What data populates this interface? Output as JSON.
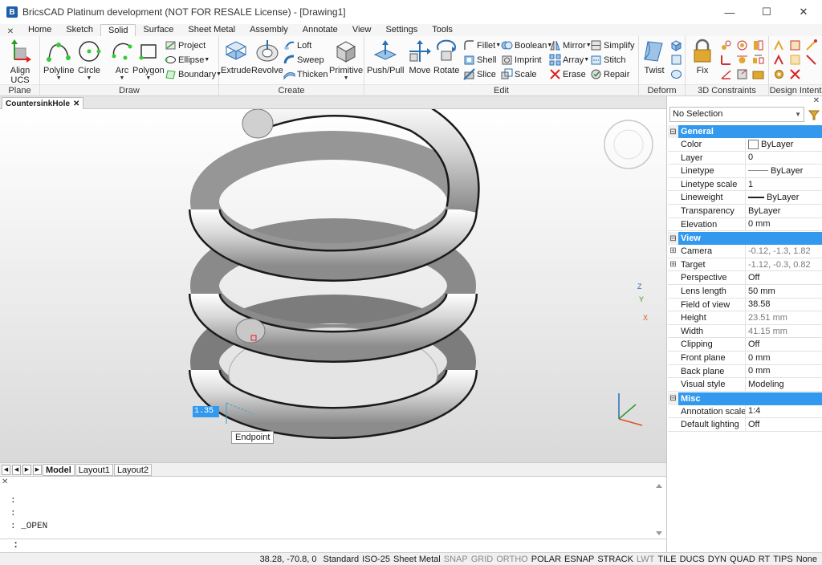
{
  "app": {
    "title": "BricsCAD Platinum development (NOT FOR RESALE License) - [Drawing1]",
    "logo_glyph": "B"
  },
  "window_controls": {
    "minimize": "—",
    "maximize": "☐",
    "close": "✕"
  },
  "ribbon_tabs": [
    "Home",
    "Sketch",
    "Solid",
    "Surface",
    "Sheet Metal",
    "Assembly",
    "Annotate",
    "View",
    "Settings",
    "Tools"
  ],
  "active_tab": "Solid",
  "ribbon": {
    "plane": {
      "label": "Plane",
      "align_ucs": "Align\nUCS"
    },
    "draw": {
      "label": "Draw",
      "polyline": "Polyline",
      "circle": "Circle",
      "arc": "Arc",
      "polygon": "Polygon",
      "project": "Project",
      "ellipse": "Ellipse",
      "boundary": "Boundary"
    },
    "create": {
      "label": "Create",
      "extrude": "Extrude",
      "revolve": "Revolve",
      "loft": "Loft",
      "sweep": "Sweep",
      "thicken": "Thicken",
      "primitive": "Primitive"
    },
    "edit": {
      "label": "Edit",
      "pushpull": "Push/Pull",
      "move": "Move",
      "rotate": "Rotate",
      "fillet": "Fillet",
      "shell": "Shell",
      "slice": "Slice",
      "boolean": "Boolean",
      "imprint": "Imprint",
      "scale": "Scale",
      "mirror": "Mirror",
      "array": "Array",
      "erase": "Erase",
      "simplify": "Simplify",
      "stitch": "Stitch",
      "repair": "Repair"
    },
    "deform": {
      "label": "Deform",
      "twist": "Twist"
    },
    "constraints": {
      "label": "3D Constraints",
      "fix": "Fix"
    },
    "design_intent": {
      "label": "Design Intent"
    }
  },
  "document_tab": "CountersinkHole",
  "viewport": {
    "dim_input": "1.35",
    "snap_tooltip": "Endpoint",
    "ucs_x": "X",
    "ucs_y": "Y",
    "ucs_z": "Z"
  },
  "layout_tabs": [
    "Model",
    "Layout1",
    "Layout2"
  ],
  "command_history": [
    ":",
    ":",
    ": _OPEN"
  ],
  "command_prompt": ":",
  "statusbar": {
    "coords": "38.28, -70.8, 0",
    "items": [
      {
        "text": "Standard",
        "off": false
      },
      {
        "text": "ISO-25",
        "off": false
      },
      {
        "text": "Sheet Metal",
        "off": false
      },
      {
        "text": "SNAP",
        "off": true
      },
      {
        "text": "GRID",
        "off": true
      },
      {
        "text": "ORTHO",
        "off": true
      },
      {
        "text": "POLAR",
        "off": false
      },
      {
        "text": "ESNAP",
        "off": false
      },
      {
        "text": "STRACK",
        "off": false
      },
      {
        "text": "LWT",
        "off": true
      },
      {
        "text": "TILE",
        "off": false
      },
      {
        "text": "DUCS",
        "off": false
      },
      {
        "text": "DYN",
        "off": false
      },
      {
        "text": "QUAD",
        "off": false
      },
      {
        "text": "RT",
        "off": false
      },
      {
        "text": "TIPS",
        "off": false
      },
      {
        "text": "None",
        "off": false
      }
    ]
  },
  "properties": {
    "selection": "No Selection",
    "categories": [
      {
        "name": "General",
        "rows": [
          {
            "name": "Color",
            "value": "ByLayer",
            "kind": "color"
          },
          {
            "name": "Layer",
            "value": "0"
          },
          {
            "name": "Linetype",
            "value": "ByLayer",
            "kind": "linetype"
          },
          {
            "name": "Linetype scale",
            "value": "1"
          },
          {
            "name": "Lineweight",
            "value": "ByLayer",
            "kind": "lineweight"
          },
          {
            "name": "Transparency",
            "value": "ByLayer"
          },
          {
            "name": "Elevation",
            "value": "0 mm"
          }
        ]
      },
      {
        "name": "View",
        "rows": [
          {
            "name": "Camera",
            "value": "-0.12, -1.3, 1.82",
            "expand": true,
            "dim": true
          },
          {
            "name": "Target",
            "value": "-1.12, -0.3, 0.82",
            "expand": true,
            "dim": true
          },
          {
            "name": "Perspective",
            "value": "Off"
          },
          {
            "name": "Lens length",
            "value": "50 mm"
          },
          {
            "name": "Field of view",
            "value": "38.58"
          },
          {
            "name": "Height",
            "value": "23.51 mm",
            "dim": true
          },
          {
            "name": "Width",
            "value": "41.15 mm",
            "dim": true
          },
          {
            "name": "Clipping",
            "value": "Off"
          },
          {
            "name": "Front plane",
            "value": "0 mm"
          },
          {
            "name": "Back plane",
            "value": "0 mm"
          },
          {
            "name": "Visual style",
            "value": "Modeling"
          }
        ]
      },
      {
        "name": "Misc",
        "rows": [
          {
            "name": "Annotation scale",
            "value": "1:4"
          },
          {
            "name": "Default lighting",
            "value": "Off"
          }
        ]
      }
    ]
  }
}
